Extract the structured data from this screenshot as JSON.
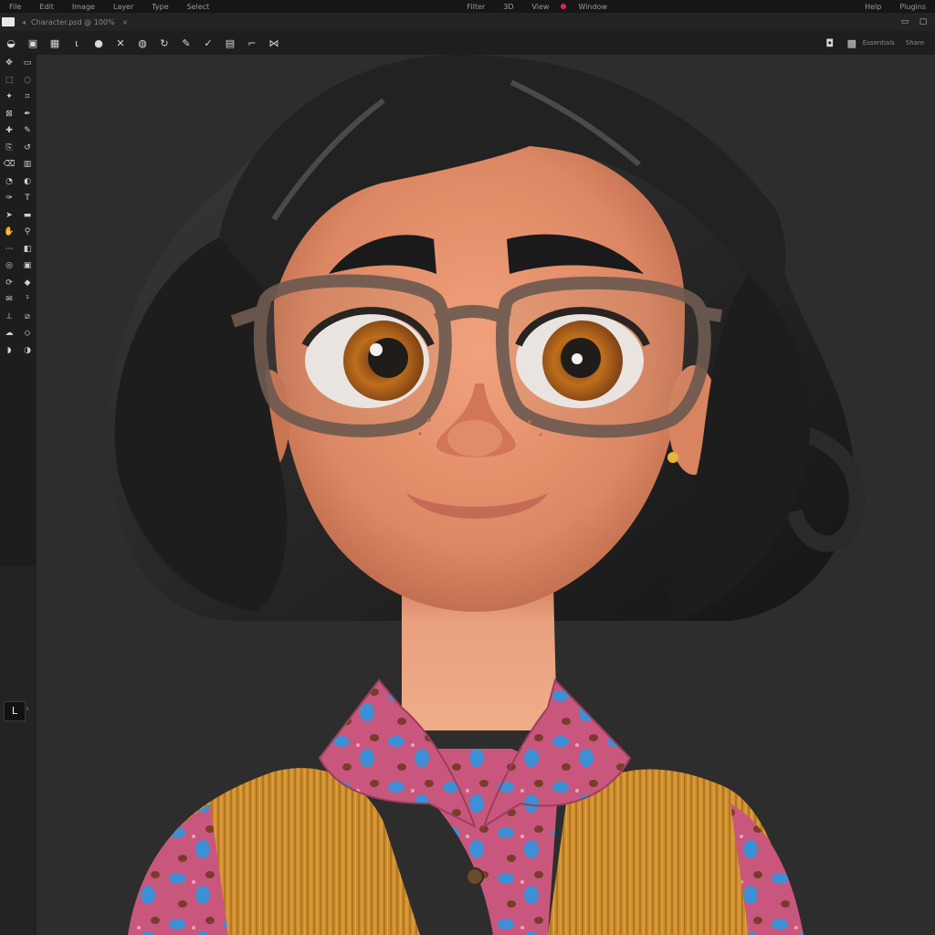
{
  "menubar": {
    "items": [
      "File",
      "Edit",
      "Image",
      "Layer",
      "Type",
      "Select",
      "Filter",
      "3D",
      "View",
      "Window",
      "Help",
      "Plugins"
    ],
    "accent_color": "#e0245e"
  },
  "tabbar": {
    "doc_title": "Character.psd @ 100%",
    "close": "×"
  },
  "optbar": {
    "right_text": [
      "Essentials",
      "Share"
    ]
  },
  "toolbar": {
    "tools": [
      "move-icon",
      "artboard-icon",
      "marquee-icon",
      "lasso-icon",
      "quick-select-icon",
      "crop-icon",
      "frame-icon",
      "eyedropper-icon",
      "heal-icon",
      "brush-icon",
      "stamp-icon",
      "history-brush-icon",
      "eraser-icon",
      "gradient-icon",
      "blur-icon",
      "dodge-icon",
      "pen-icon",
      "type-icon",
      "path-select-icon",
      "shape-icon",
      "hand-icon",
      "zoom-icon",
      "edit-toolbar-icon",
      "swatch-icon",
      "quick-mask-icon",
      "screen-mode-icon",
      "rotate-view-icon",
      "3d-icon",
      "note-icon",
      "count-icon",
      "ruler-icon",
      "slice-icon",
      "smudge-icon",
      "sharpen-icon",
      "sponge-icon",
      "burn-icon"
    ],
    "layer_button": "L",
    "expand_arrow": "›"
  },
  "canvas": {
    "subject": "3D cartoon portrait of a girl with black wavy hair, brown glasses, amber eyes, pink patterned collared shirt and mustard knit vest",
    "background_color": "#2d2d2d"
  }
}
